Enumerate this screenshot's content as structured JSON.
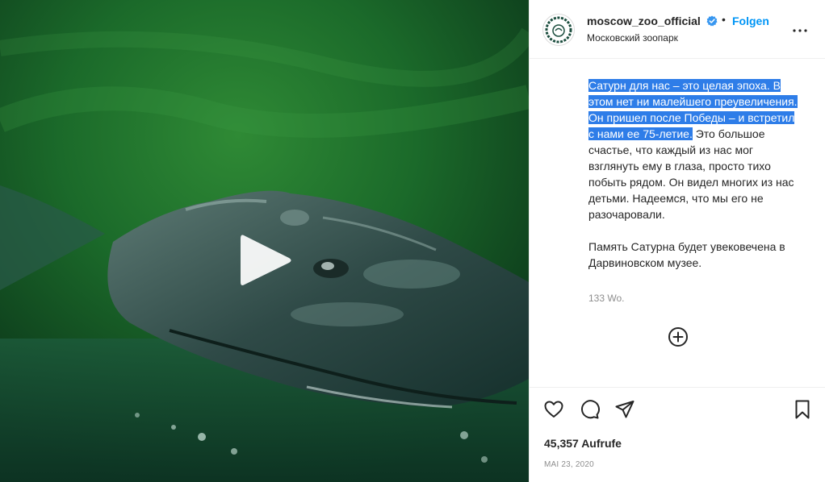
{
  "account": {
    "username": "moscow_zoo_official",
    "location": "Московский зоопарк",
    "follow_label": "Folgen",
    "separator": "•"
  },
  "caption": {
    "selected_text": "Сатурн для нас – это целая эпоха. В этом нет ни малейшего преувеличения. Он пришел после Победы – и встретил с нами ее 75-летие.",
    "rest_text": " Это большое счастье, что каждый из нас мог взглянуть ему в глаза, просто тихо побыть рядом. Он видел многих из нас детьми. Надеемся, что мы его не разочаровали.",
    "paragraph2": "Память Сатурна будет увековечена в Дарвиновском музее.",
    "time_ago": "133 Wo."
  },
  "stats": {
    "views": "45,357 Aufrufe",
    "date": "MAI 23, 2020"
  },
  "icons": {
    "verified": "verified-badge-icon",
    "more": "more-options-icon",
    "play": "play-icon",
    "load_more": "plus-circle-icon",
    "like": "heart-icon",
    "comment": "comment-icon",
    "share": "paper-plane-icon",
    "save": "bookmark-icon"
  },
  "colors": {
    "accent": "#0095f6",
    "selection": "#2e7de8",
    "muted": "#8e8e8e"
  }
}
